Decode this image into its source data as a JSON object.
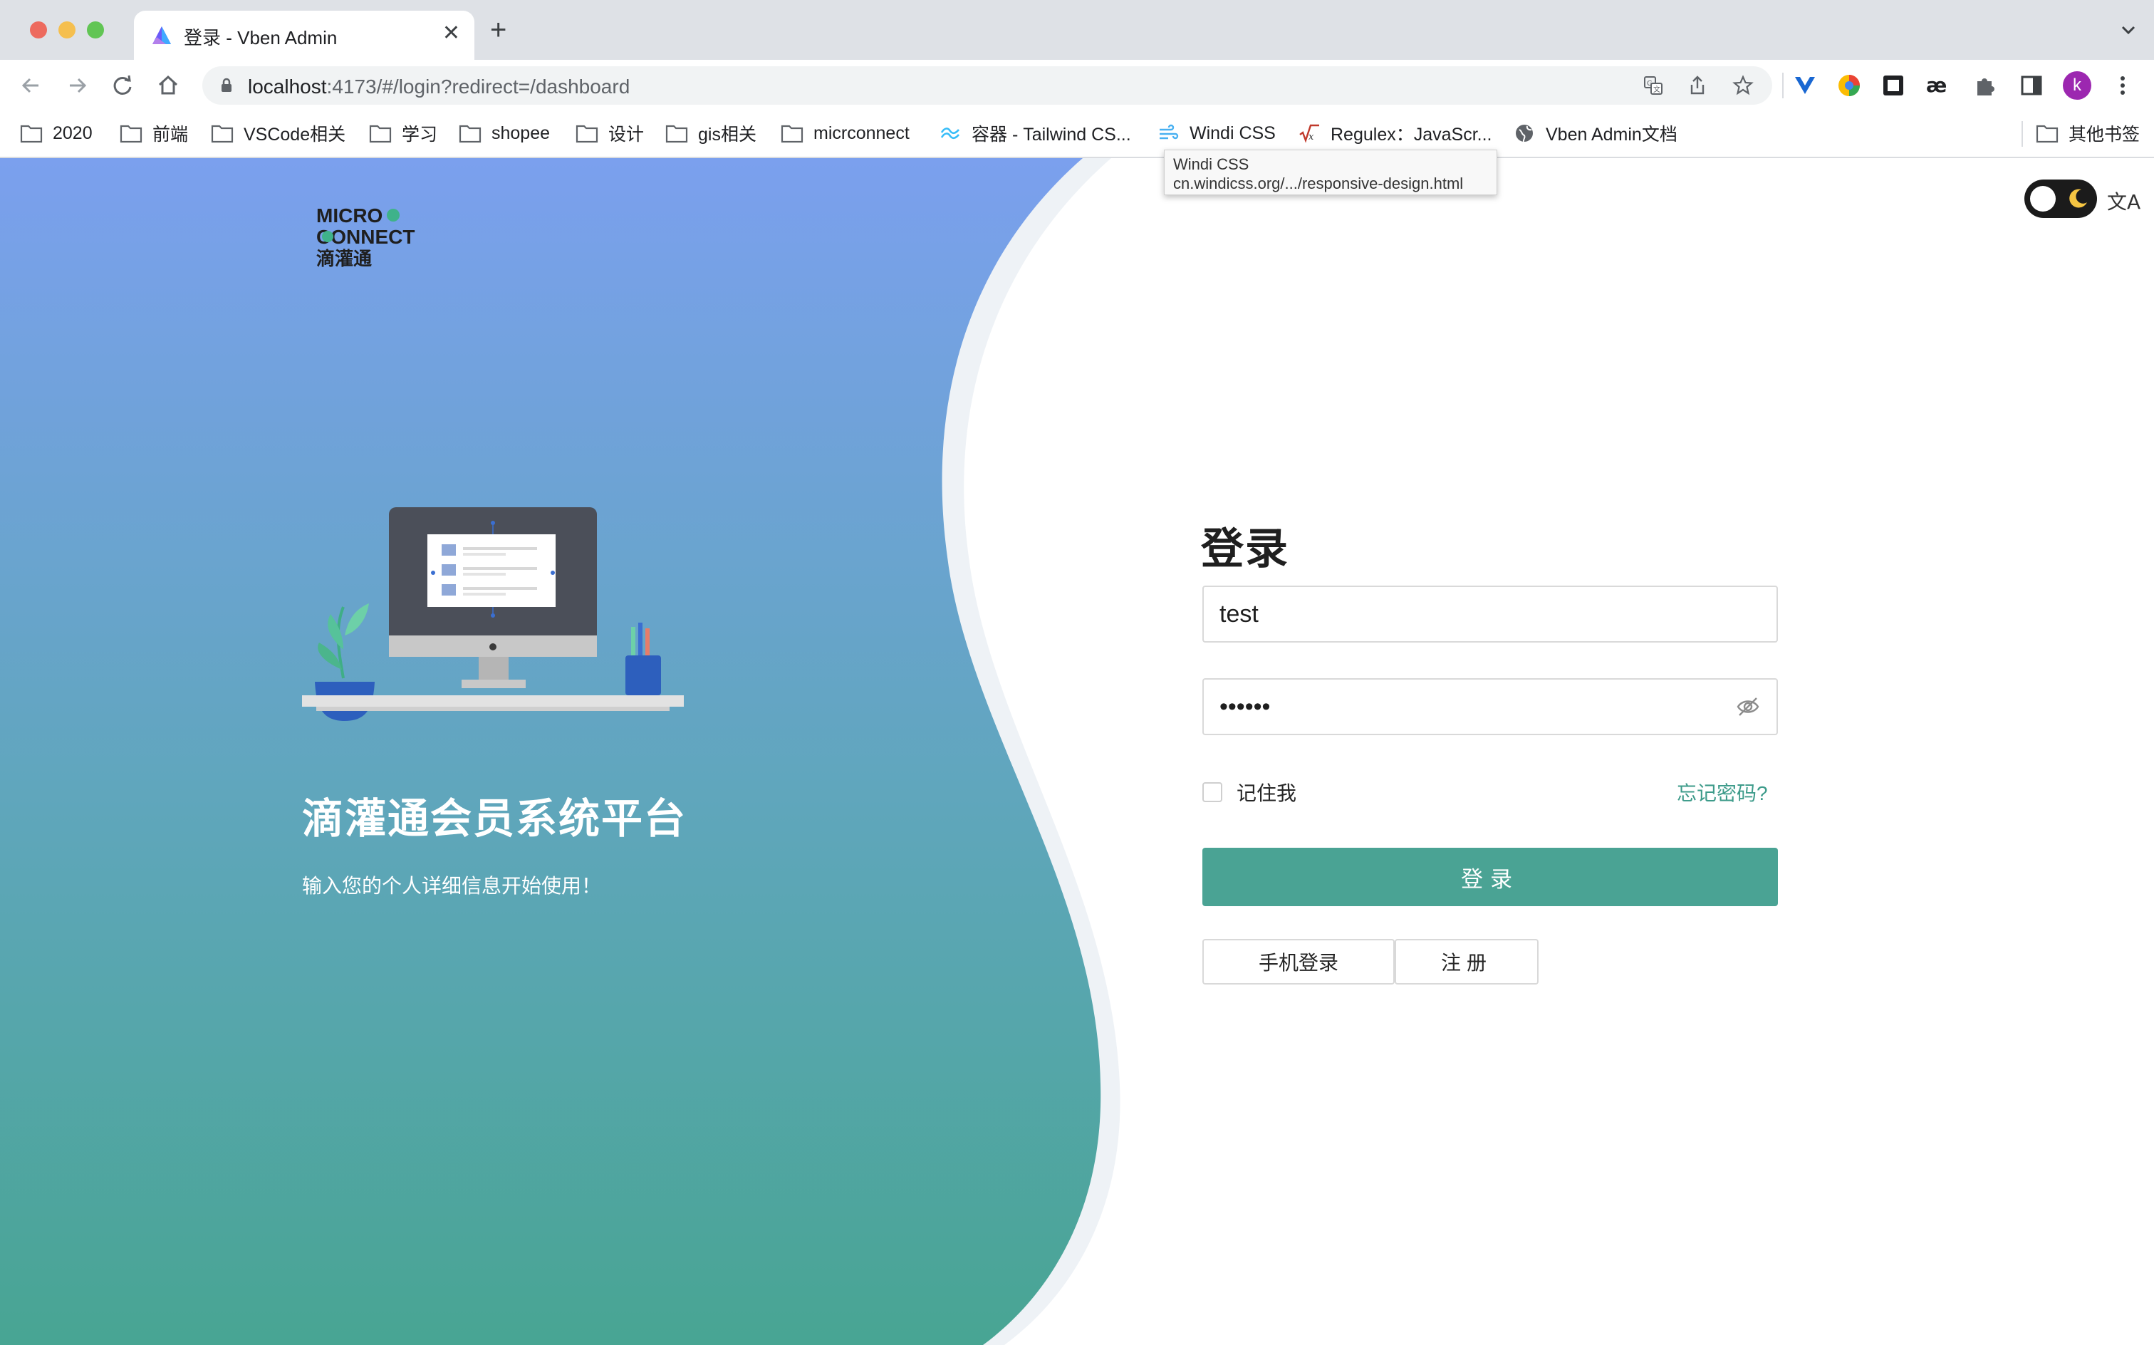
{
  "browser": {
    "tab": {
      "title": "登录 - Vben Admin",
      "favicon": "vben-logo-icon",
      "close_symbol": "✕"
    },
    "new_tab_symbol": "+",
    "url": {
      "host": "localhost",
      "rest": ":4173/#/login?redirect=/dashboard"
    },
    "bookmarks": [
      {
        "label": "2020",
        "icon": "folder-icon"
      },
      {
        "label": "前端",
        "icon": "folder-icon"
      },
      {
        "label": "VSCode相关",
        "icon": "folder-icon"
      },
      {
        "label": "学习",
        "icon": "folder-icon"
      },
      {
        "label": "shopee",
        "icon": "folder-icon"
      },
      {
        "label": "设计",
        "icon": "folder-icon"
      },
      {
        "label": "gis相关",
        "icon": "folder-icon"
      },
      {
        "label": "micrconnect",
        "icon": "folder-icon"
      },
      {
        "label": "容器 - Tailwind CS...",
        "icon": "tailwind-icon"
      },
      {
        "label": "Windi CSS",
        "icon": "windi-icon"
      },
      {
        "label": "Regulex：JavaScr...",
        "icon": "regulex-icon"
      },
      {
        "label": "Vben Admin文档",
        "icon": "globe-icon"
      }
    ],
    "other_bookmarks": "其他书签",
    "tooltip": {
      "title": "Windi CSS",
      "url": "cn.windicss.org/.../responsive-design.html"
    },
    "profile_initial": "k"
  },
  "page": {
    "logo": {
      "line1": "MICRO",
      "line2": "CONNECT",
      "line3": "滴灌通"
    },
    "hero_title": "滴灌通会员系统平台",
    "hero_subtitle": "输入您的个人详细信息开始使用！",
    "lang_symbol": "文A"
  },
  "login": {
    "title": "登录",
    "username_value": "test",
    "password_value": "123456",
    "remember_label": "记住我",
    "remember_checked": false,
    "forgot_label": "忘记密码?",
    "submit_label": "登录",
    "phone_login_label": "手机登录",
    "register_label": "注册"
  },
  "colors": {
    "primary": "#4aa394",
    "gradient_top": "#7ba0ee",
    "gradient_bottom": "#48a593",
    "dark_toggle": "#1b1b1b"
  }
}
